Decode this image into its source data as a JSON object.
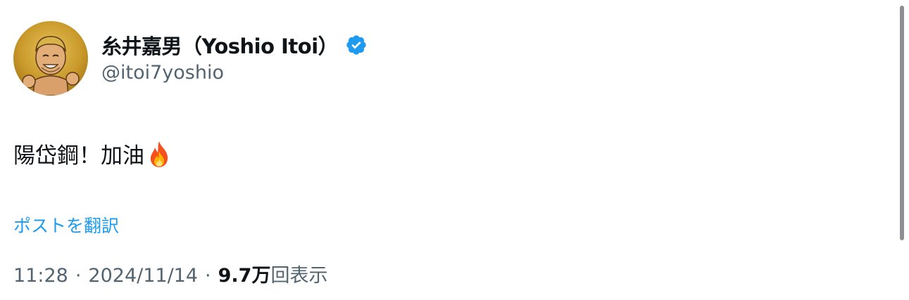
{
  "author": {
    "display_name": "糸井嘉男（Yoshio Itoi）",
    "handle": "@itoi7yoshio",
    "verified": true,
    "avatar_icon": "cartoon-avatar-icon",
    "verified_icon": "verified-badge-icon"
  },
  "post": {
    "text": "陽岱鋼！加油",
    "emoji_icon": "fire-emoji-icon"
  },
  "actions": {
    "translate_label": "ポストを翻訳"
  },
  "meta": {
    "time": "11:28",
    "separator": "·",
    "date": "2024/11/14",
    "views_count": "9.7万",
    "views_label": "回表示"
  },
  "colors": {
    "text_primary": "#0f1419",
    "text_secondary": "#536471",
    "link": "#1d9bf0",
    "verified": "#1d9bf0"
  }
}
